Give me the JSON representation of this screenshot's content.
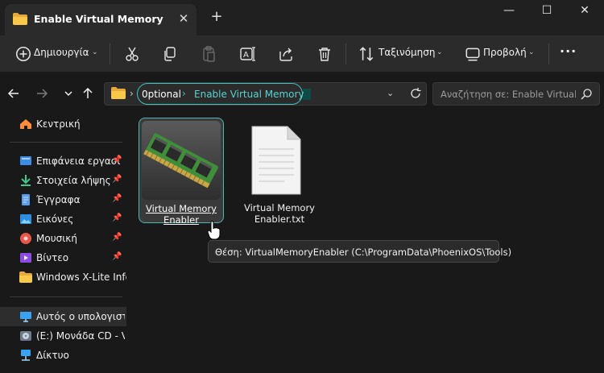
{
  "window": {
    "tab_title": "Enable Virtual Memory",
    "close_tab": "✕",
    "new_tab": "+",
    "minimize": "—",
    "maximize": "☐",
    "close": "✕"
  },
  "toolbar": {
    "new_label": "Δημιουργία",
    "sort_label": "Ταξινόμηση",
    "view_label": "Προβολή",
    "more_label": "···"
  },
  "address": {
    "segments": [
      "0ptional",
      "Enable Virtual Memory"
    ],
    "separator": "›"
  },
  "search": {
    "placeholder": "Αναζήτηση σε: Enable Virtual ..."
  },
  "sidebar": {
    "items": [
      {
        "label": "Κεντρική",
        "icon": "home-icon"
      },
      {
        "label": "Επιφάνεια εργασί",
        "icon": "desktop-icon",
        "pinned": true
      },
      {
        "label": "Στοιχεία λήψης",
        "icon": "download-icon",
        "pinned": true
      },
      {
        "label": "Έγγραφα",
        "icon": "documents-icon",
        "pinned": true
      },
      {
        "label": "Εικόνες",
        "icon": "pictures-icon",
        "pinned": true
      },
      {
        "label": "Μουσική",
        "icon": "music-icon",
        "pinned": true
      },
      {
        "label": "Βίντεο",
        "icon": "video-icon",
        "pinned": true
      },
      {
        "label": "Windows X-Lite Info",
        "icon": "folder-icon"
      },
      {
        "label": "Αυτός ο υπολογιστής",
        "icon": "this-pc-icon"
      },
      {
        "label": "(E:) Μονάδα CD - Vir",
        "icon": "cd-drive-icon"
      },
      {
        "label": "Δίκτυο",
        "icon": "network-icon"
      }
    ]
  },
  "files": [
    {
      "label": "Virtual Memory Enabler",
      "icon": "ram-module-icon",
      "selected": true
    },
    {
      "label": "Virtual Memory Enabler.txt",
      "icon": "text-file-icon"
    }
  ],
  "tooltip": "Θέση: VirtualMemoryEnabler (C:\\ProgramData\\PhoenixOS\\Tools)",
  "colors": {
    "accent": "#3ec6c1",
    "folder": "#f5c342",
    "background": "#191919",
    "toolbar": "#2b2b2b"
  }
}
